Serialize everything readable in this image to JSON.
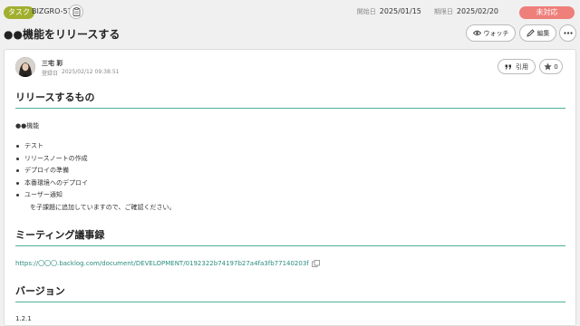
{
  "header": {
    "issue_type": "タスク",
    "issue_key": "BIZGRO-57",
    "start_label": "開始日",
    "start_date": "2025/01/15",
    "due_label": "期限日",
    "due_date": "2025/02/20",
    "status": "未対応"
  },
  "title": "●●機能をリリースする",
  "actions": {
    "watch": "ウォッチ",
    "edit": "編集"
  },
  "comment": {
    "author": "三宅 彩",
    "posted_label": "登録日",
    "posted_at": "2025/02/12 09:38:51",
    "quote": "引用",
    "star_count": "0"
  },
  "sections": {
    "release": {
      "heading": "リリースするもの",
      "feature": "●●機能",
      "items": [
        "テスト",
        "リリースノートの作成",
        "デプロイの準備",
        "本番環境へのデプロイ",
        "ユーザー通知"
      ],
      "note": "を子課題に追加していますので、ご確認ください。"
    },
    "meeting": {
      "heading": "ミーティング議事録",
      "link": "https://〇〇〇.backlog.com/document/DEVELOPMENT/0192322b74197b27a4fa3fb77140203f"
    },
    "version": {
      "heading": "バージョン",
      "value": "1.2.1"
    }
  },
  "colors": {
    "accent": "#4caf9b",
    "status": "#ee7f7a",
    "type": "#a1af2f",
    "link": "#2a8d7e"
  }
}
